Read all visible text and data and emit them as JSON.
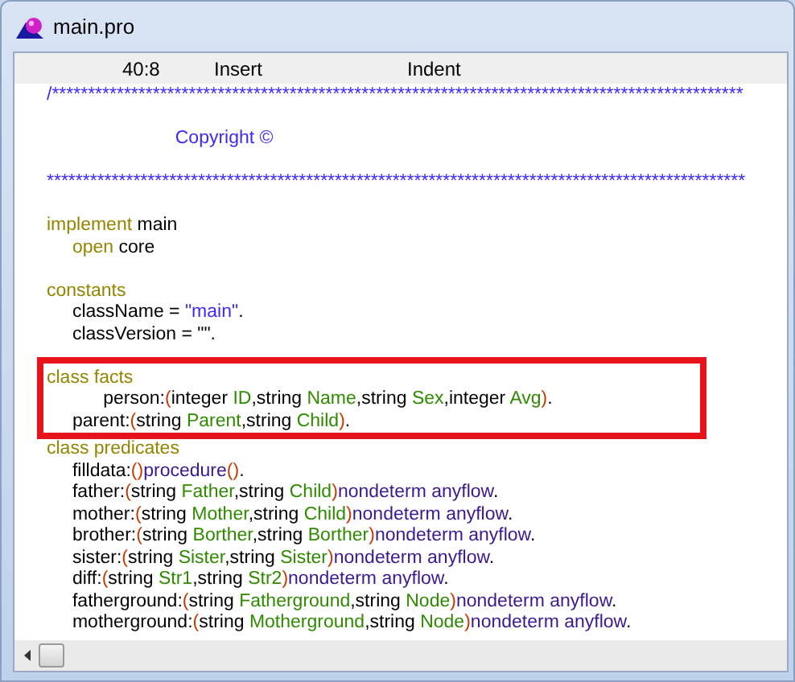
{
  "window": {
    "title": "main.pro"
  },
  "status_bar": {
    "position": "40:8",
    "mode": "Insert",
    "indent": "Indent"
  },
  "editor": {
    "blocks": [
      {
        "lines": [
          {
            "highlighted": false,
            "tokens": [
              {
                "kind": "comment",
                "text": "/************************************************************************************************"
              }
            ]
          }
        ]
      },
      {
        "lines": [
          {
            "highlighted": false,
            "tokens": [
              {
                "kind": "comment",
                "text": "                         Copyright ©"
              }
            ]
          }
        ]
      },
      {
        "lines": [
          {
            "highlighted": false,
            "tokens": [
              {
                "kind": "comment",
                "text": "*************************************************************************************************"
              }
            ]
          }
        ]
      },
      {
        "lines": [
          {
            "highlighted": false,
            "tokens": [
              {
                "kind": "keyword",
                "text": "implement"
              },
              {
                "kind": "plain",
                "text": " main"
              }
            ]
          },
          {
            "highlighted": false,
            "tokens": [
              {
                "kind": "keyword",
                "text": "     open"
              },
              {
                "kind": "plain",
                "text": " core"
              }
            ]
          }
        ]
      },
      {
        "lines": [
          {
            "highlighted": false,
            "tokens": [
              {
                "kind": "keyword",
                "text": "constants"
              }
            ]
          },
          {
            "highlighted": false,
            "tokens": [
              {
                "kind": "plain",
                "text": "     className = "
              },
              {
                "kind": "string",
                "text": "\"main\""
              },
              {
                "kind": "plain",
                "text": "."
              }
            ]
          },
          {
            "highlighted": false,
            "tokens": [
              {
                "kind": "plain",
                "text": "     classVersion = \"\"."
              }
            ]
          }
        ]
      },
      {
        "lines": [
          {
            "highlighted": true,
            "tokens": [
              {
                "kind": "keyword",
                "text": "class facts"
              }
            ]
          },
          {
            "highlighted": true,
            "tokens": [
              {
                "kind": "plain",
                "text": "           person:"
              },
              {
                "kind": "paren",
                "text": "("
              },
              {
                "kind": "plain",
                "text": "integer "
              },
              {
                "kind": "var",
                "text": "ID"
              },
              {
                "kind": "plain",
                "text": ",string "
              },
              {
                "kind": "var",
                "text": "Name"
              },
              {
                "kind": "plain",
                "text": ",string "
              },
              {
                "kind": "var",
                "text": "Sex"
              },
              {
                "kind": "plain",
                "text": ",integer "
              },
              {
                "kind": "var",
                "text": "Avg"
              },
              {
                "kind": "paren",
                "text": ")"
              },
              {
                "kind": "plain",
                "text": "."
              }
            ]
          },
          {
            "highlighted": true,
            "tokens": [
              {
                "kind": "plain",
                "text": "     parent:"
              },
              {
                "kind": "paren",
                "text": "("
              },
              {
                "kind": "plain",
                "text": "string "
              },
              {
                "kind": "var",
                "text": "Parent"
              },
              {
                "kind": "plain",
                "text": ",string "
              },
              {
                "kind": "var",
                "text": "Child"
              },
              {
                "kind": "paren",
                "text": ")"
              },
              {
                "kind": "plain",
                "text": "."
              }
            ]
          },
          {
            "highlighted": false,
            "tokens": [
              {
                "kind": "keyword",
                "text": "class predicates"
              }
            ]
          },
          {
            "highlighted": false,
            "tokens": [
              {
                "kind": "plain",
                "text": "     filldata:"
              },
              {
                "kind": "paren",
                "text": "()"
              },
              {
                "kind": "mode",
                "text": "procedure"
              },
              {
                "kind": "paren",
                "text": "()"
              },
              {
                "kind": "plain",
                "text": "."
              }
            ]
          },
          {
            "highlighted": false,
            "tokens": [
              {
                "kind": "plain",
                "text": "     father:"
              },
              {
                "kind": "paren",
                "text": "("
              },
              {
                "kind": "plain",
                "text": "string "
              },
              {
                "kind": "var",
                "text": "Father"
              },
              {
                "kind": "plain",
                "text": ",string "
              },
              {
                "kind": "var",
                "text": "Child"
              },
              {
                "kind": "paren",
                "text": ")"
              },
              {
                "kind": "mode",
                "text": "nondeterm anyflow"
              },
              {
                "kind": "plain",
                "text": "."
              }
            ]
          },
          {
            "highlighted": false,
            "tokens": [
              {
                "kind": "plain",
                "text": "     mother:"
              },
              {
                "kind": "paren",
                "text": "("
              },
              {
                "kind": "plain",
                "text": "string "
              },
              {
                "kind": "var",
                "text": "Mother"
              },
              {
                "kind": "plain",
                "text": ",string "
              },
              {
                "kind": "var",
                "text": "Child"
              },
              {
                "kind": "paren",
                "text": ")"
              },
              {
                "kind": "mode",
                "text": "nondeterm anyflow"
              },
              {
                "kind": "plain",
                "text": "."
              }
            ]
          },
          {
            "highlighted": false,
            "tokens": [
              {
                "kind": "plain",
                "text": "     brother:"
              },
              {
                "kind": "paren",
                "text": "("
              },
              {
                "kind": "plain",
                "text": "string "
              },
              {
                "kind": "var",
                "text": "Borther"
              },
              {
                "kind": "plain",
                "text": ",string "
              },
              {
                "kind": "var",
                "text": "Borther"
              },
              {
                "kind": "paren",
                "text": ")"
              },
              {
                "kind": "mode",
                "text": "nondeterm anyflow"
              },
              {
                "kind": "plain",
                "text": "."
              }
            ]
          },
          {
            "highlighted": false,
            "tokens": [
              {
                "kind": "plain",
                "text": "     sister:"
              },
              {
                "kind": "paren",
                "text": "("
              },
              {
                "kind": "plain",
                "text": "string "
              },
              {
                "kind": "var",
                "text": "Sister"
              },
              {
                "kind": "plain",
                "text": ",string "
              },
              {
                "kind": "var",
                "text": "Sister"
              },
              {
                "kind": "paren",
                "text": ")"
              },
              {
                "kind": "mode",
                "text": "nondeterm anyflow"
              },
              {
                "kind": "plain",
                "text": "."
              }
            ]
          },
          {
            "highlighted": false,
            "tokens": [
              {
                "kind": "plain",
                "text": "     diff:"
              },
              {
                "kind": "paren",
                "text": "("
              },
              {
                "kind": "plain",
                "text": "string "
              },
              {
                "kind": "var",
                "text": "Str1"
              },
              {
                "kind": "plain",
                "text": ",string "
              },
              {
                "kind": "var",
                "text": "Str2"
              },
              {
                "kind": "paren",
                "text": ")"
              },
              {
                "kind": "mode",
                "text": "nondeterm anyflow"
              },
              {
                "kind": "plain",
                "text": "."
              }
            ]
          },
          {
            "highlighted": false,
            "tokens": [
              {
                "kind": "plain",
                "text": "     fatherground:"
              },
              {
                "kind": "paren",
                "text": "("
              },
              {
                "kind": "plain",
                "text": "string "
              },
              {
                "kind": "var",
                "text": "Fatherground"
              },
              {
                "kind": "plain",
                "text": ",string "
              },
              {
                "kind": "var",
                "text": "Node"
              },
              {
                "kind": "paren",
                "text": ")"
              },
              {
                "kind": "mode",
                "text": "nondeterm anyflow"
              },
              {
                "kind": "plain",
                "text": "."
              }
            ]
          },
          {
            "highlighted": false,
            "tokens": [
              {
                "kind": "plain",
                "text": "     motherground:"
              },
              {
                "kind": "paren",
                "text": "("
              },
              {
                "kind": "plain",
                "text": "string "
              },
              {
                "kind": "var",
                "text": "Motherground"
              },
              {
                "kind": "plain",
                "text": ",string "
              },
              {
                "kind": "var",
                "text": "Node"
              },
              {
                "kind": "paren",
                "text": ")"
              },
              {
                "kind": "mode",
                "text": "nondeterm anyflow"
              },
              {
                "kind": "plain",
                "text": "."
              }
            ]
          }
        ]
      }
    ]
  }
}
